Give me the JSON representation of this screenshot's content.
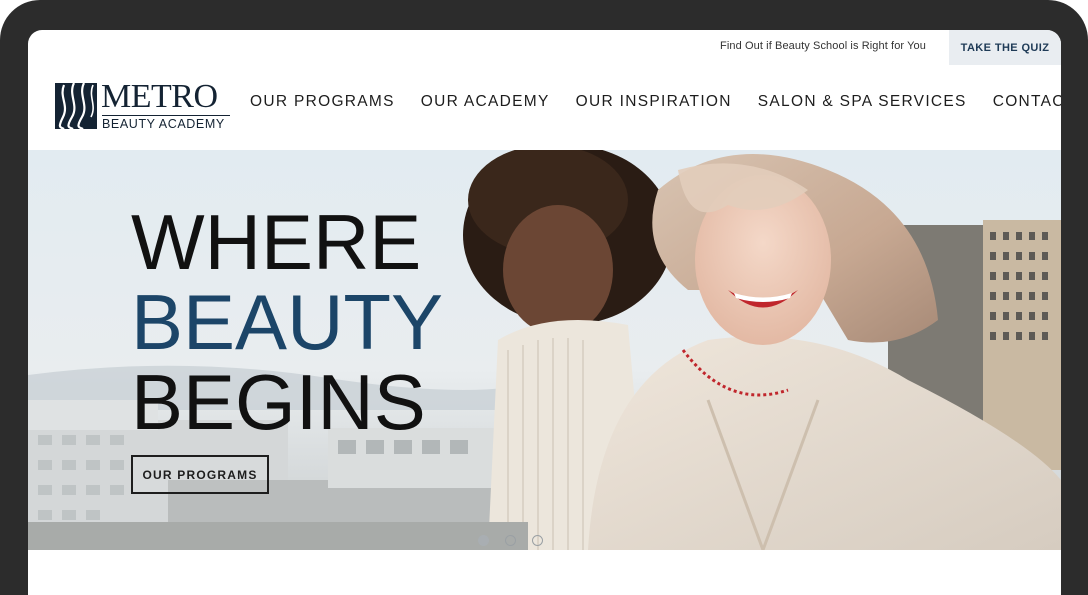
{
  "topbar": {
    "quiz_prompt": "Find Out if Beauty School is Right for You",
    "quiz_button": "TAKE THE QUIZ"
  },
  "logo": {
    "name": "METRO",
    "subtitle": "BEAUTY ACADEMY",
    "icon": "metro-wave-icon"
  },
  "nav": {
    "items": [
      {
        "label": "OUR PROGRAMS"
      },
      {
        "label": "OUR ACADEMY"
      },
      {
        "label": "OUR INSPIRATION"
      },
      {
        "label": "SALON & SPA SERVICES"
      },
      {
        "label": "CONTACT"
      }
    ]
  },
  "hero": {
    "line1": "WHERE",
    "line2": "BEAUTY",
    "line3": "BEGINS",
    "button": "OUR PROGRAMS",
    "accent_color": "#1c4568"
  },
  "carousel": {
    "total_slides": 3,
    "active_slide": 1
  },
  "colors": {
    "device_frame": "#2c2c2c",
    "quiz_button_bg": "#e9edf1",
    "brand_navy": "#142333"
  }
}
